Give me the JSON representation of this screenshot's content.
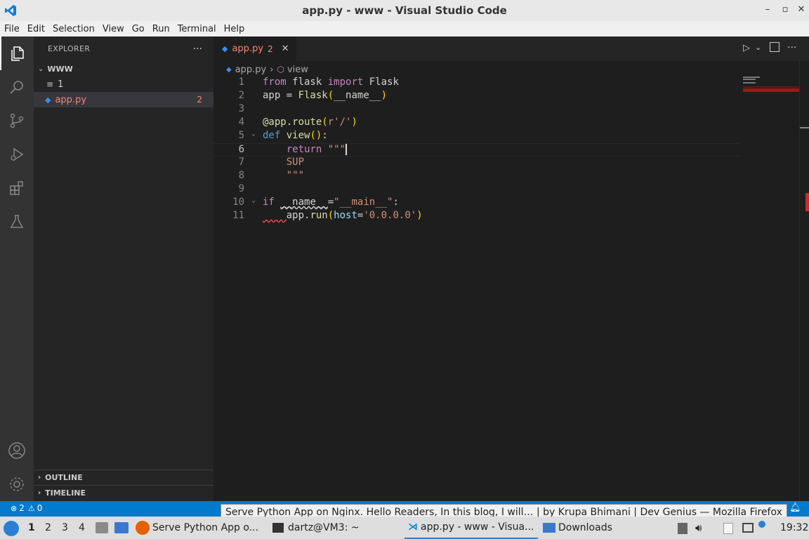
{
  "window": {
    "title": "app.py - www - Visual Studio Code"
  },
  "menu": [
    "File",
    "Edit",
    "Selection",
    "View",
    "Go",
    "Run",
    "Terminal",
    "Help"
  ],
  "sidebar": {
    "header": "EXPLORER",
    "folder": "WWW",
    "items": [
      {
        "label": "1"
      },
      {
        "label": "app.py",
        "badge": "2"
      }
    ],
    "outline": "OUTLINE",
    "timeline": "TIMELINE"
  },
  "tab": {
    "label": "app.py",
    "badge": "2"
  },
  "breadcrumb": {
    "file": "app.py",
    "symbol": "view"
  },
  "code": {
    "line_numbers": [
      "1",
      "2",
      "3",
      "4",
      "5",
      "6",
      "7",
      "8",
      "9",
      "10",
      "11"
    ]
  },
  "status": {
    "errors": "2",
    "warnings": "0"
  },
  "tooltip": "Serve Python App on Nginx. Hello Readers, In this blog, I will… | by Krupa Bhimani | Dev Genius — Mozilla Firefox",
  "taskbar": {
    "workspaces": [
      "1",
      "2",
      "3",
      "4"
    ],
    "firefox": "Serve Python App o...",
    "terminal": "dartz@VM3: ~",
    "vscode": "app.py - www - Visua...",
    "files": "Downloads",
    "clock": "19:32"
  },
  "colors": {
    "accent": "#007acc",
    "error": "#f48771",
    "modified": "#e2c08d"
  }
}
